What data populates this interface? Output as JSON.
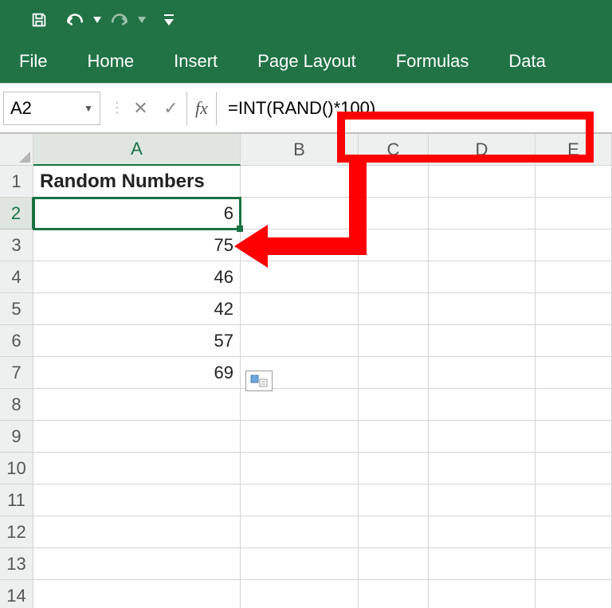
{
  "qat": {
    "icons": [
      "save-icon",
      "undo-icon",
      "redo-icon",
      "customize-qat-icon"
    ]
  },
  "ribbon": {
    "tabs": [
      "File",
      "Home",
      "Insert",
      "Page Layout",
      "Formulas",
      "Data"
    ]
  },
  "formula_bar": {
    "name_box": "A2",
    "cancel_glyph": "✕",
    "enter_glyph": "✓",
    "fx_glyph": "fx",
    "formula": "=INT(RAND()*100)"
  },
  "columns": [
    "A",
    "B",
    "C",
    "D",
    "E"
  ],
  "rows": [
    "1",
    "2",
    "3",
    "4",
    "5",
    "6",
    "7",
    "8",
    "9",
    "10",
    "11",
    "12",
    "13",
    "14"
  ],
  "cells": {
    "A1": "Random Numbers",
    "A2": "6",
    "A3": "75",
    "A4": "46",
    "A5": "42",
    "A6": "57",
    "A7": "69"
  },
  "active_cell": "A2",
  "annotation": {
    "color": "#fe0000"
  }
}
